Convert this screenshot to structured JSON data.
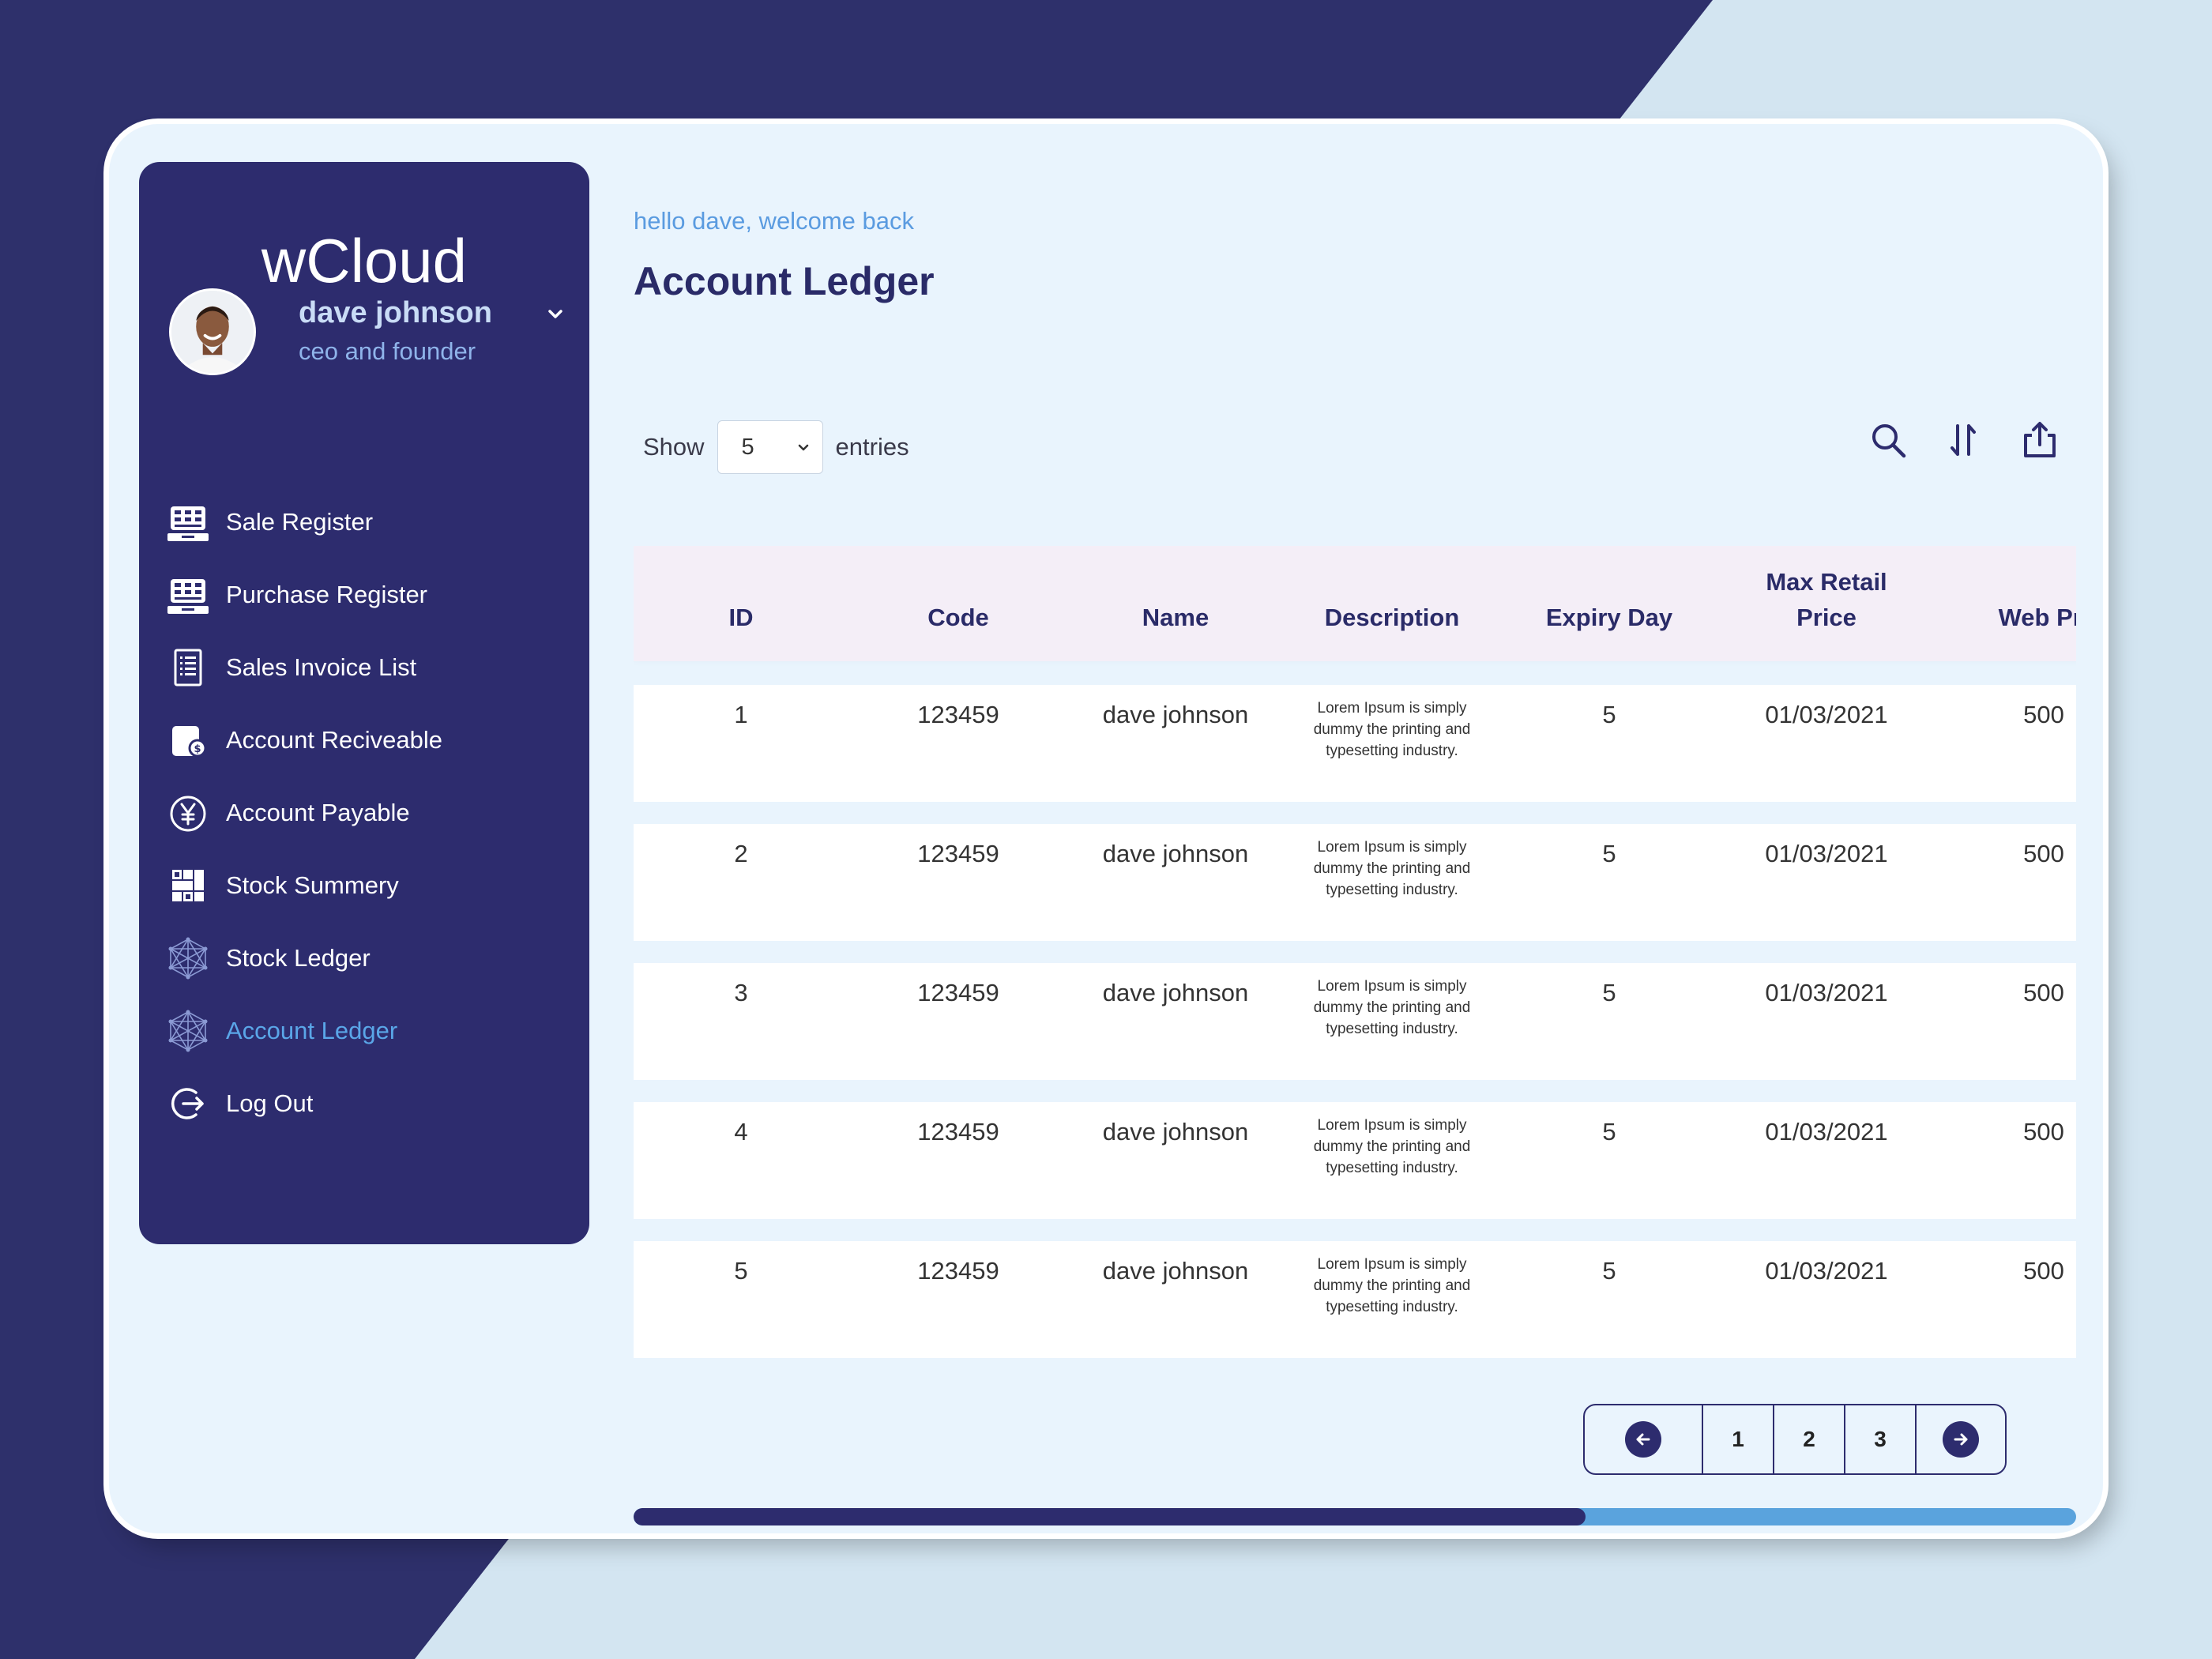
{
  "app": {
    "brand": "wCloud"
  },
  "user": {
    "name": "dave johnson",
    "role": "ceo and founder"
  },
  "sidebar": {
    "items": [
      {
        "label": "Sale Register",
        "icon": "register-icon"
      },
      {
        "label": "Purchase Register",
        "icon": "register-icon"
      },
      {
        "label": "Sales Invoice List",
        "icon": "invoice-icon"
      },
      {
        "label": "Account Reciveable",
        "icon": "receivable-icon"
      },
      {
        "label": "Account Payable",
        "icon": "yen-icon"
      },
      {
        "label": "Stock Summery",
        "icon": "grid-icon"
      },
      {
        "label": "Stock Ledger",
        "icon": "network-icon"
      },
      {
        "label": "Account Ledger",
        "icon": "network-icon",
        "active": true
      },
      {
        "label": "Log Out",
        "icon": "logout-icon"
      }
    ]
  },
  "header": {
    "greeting": "hello dave, welcome back",
    "title": "Account Ledger"
  },
  "controls": {
    "show_label": "Show",
    "entries_value": "5",
    "entries_label": "entries"
  },
  "table": {
    "columns": [
      "ID",
      "Code",
      "Name",
      "Description",
      "Expiry Day",
      "Max Retail Price",
      "Web Pri"
    ],
    "rows": [
      {
        "id": "1",
        "code": "123459",
        "name": "dave johnson",
        "desc": "Lorem Ipsum is simply dummy the printing and typesetting industry.",
        "expiry": "5",
        "mrp": "01/03/2021",
        "web": "500"
      },
      {
        "id": "2",
        "code": "123459",
        "name": "dave johnson",
        "desc": "Lorem Ipsum is simply dummy the printing and typesetting industry.",
        "expiry": "5",
        "mrp": "01/03/2021",
        "web": "500"
      },
      {
        "id": "3",
        "code": "123459",
        "name": "dave johnson",
        "desc": "Lorem Ipsum is simply dummy the printing and typesetting industry.",
        "expiry": "5",
        "mrp": "01/03/2021",
        "web": "500"
      },
      {
        "id": "4",
        "code": "123459",
        "name": "dave johnson",
        "desc": "Lorem Ipsum is simply dummy the printing and typesetting industry.",
        "expiry": "5",
        "mrp": "01/03/2021",
        "web": "500"
      },
      {
        "id": "5",
        "code": "123459",
        "name": "dave johnson",
        "desc": "Lorem Ipsum is simply dummy the printing and typesetting industry.",
        "expiry": "5",
        "mrp": "01/03/2021",
        "web": "500"
      }
    ]
  },
  "pagination": {
    "pages": [
      "1",
      "2",
      "3"
    ]
  },
  "scroll": {
    "fraction": 0.66
  },
  "colors": {
    "navy": "#2d2c6e",
    "accent": "#5aa6e8",
    "card": "#e9f4fd",
    "header_row": "#f4eef7"
  }
}
